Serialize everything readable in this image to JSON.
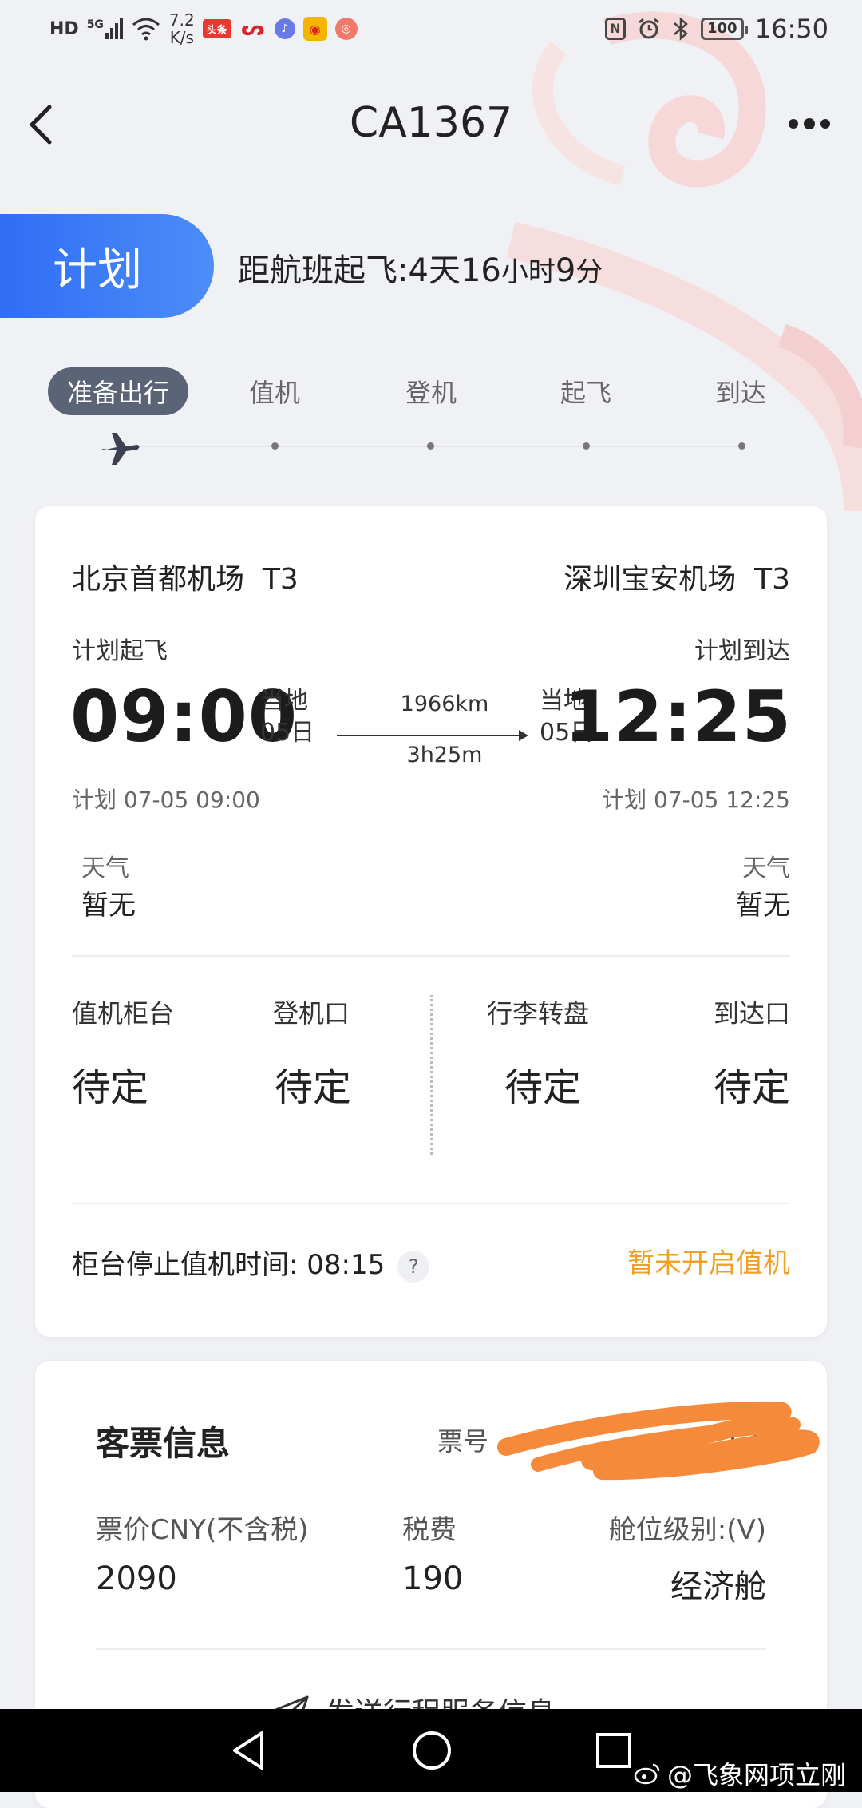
{
  "status_bar": {
    "network": "HD",
    "signal": "5G",
    "speed_value": "7.2",
    "speed_unit": "K/s",
    "app_icon_toutiao": "头条",
    "battery": "100",
    "time": "16:50"
  },
  "header": {
    "title": "CA1367"
  },
  "plan": {
    "badge": "计划",
    "countdown_prefix": "距航班起飞:",
    "days": "4",
    "days_unit": "天",
    "hours": "16",
    "hours_unit": "小时",
    "minutes": "9",
    "minutes_unit": "分"
  },
  "progress": {
    "steps": [
      "准备出行",
      "值机",
      "登机",
      "起飞",
      "到达"
    ],
    "active_index": 0
  },
  "flight": {
    "departure_airport": "北京首都机场",
    "departure_terminal": "T3",
    "arrival_airport": "深圳宝安机场",
    "arrival_terminal": "T3",
    "dep_label": "计划起飞",
    "arr_label": "计划到达",
    "dep_time": "09:00",
    "arr_time": "12:25",
    "local_label": "当地",
    "dep_day": "05日",
    "arr_day": "05日",
    "distance": "1966km",
    "duration": "3h25m",
    "dep_plan": "计划 07-05 09:00",
    "arr_plan": "计划 07-05 12:25",
    "weather_label": "天气",
    "dep_weather": "暂无",
    "arr_weather": "暂无"
  },
  "airport_info": {
    "checkin_counter_label": "值机柜台",
    "checkin_counter_value": "待定",
    "gate_label": "登机口",
    "gate_value": "待定",
    "baggage_label": "行李转盘",
    "baggage_value": "待定",
    "exit_label": "到达口",
    "exit_value": "待定"
  },
  "checkin": {
    "stop_label": "柜台停止值机时间: 08:15",
    "help": "?",
    "status": "暂未开启值机"
  },
  "ticket": {
    "title": "客票信息",
    "ticket_no_label": "票号",
    "price_label": "票价CNY(不含税)",
    "price_value": "2090",
    "tax_label": "税费",
    "tax_value": "190",
    "cabin_label": "舱位级别:(V)",
    "cabin_value": "经济舱",
    "send_label": "发送行程服务信息"
  },
  "watermark": "@飞象网项立刚",
  "colors": {
    "accent_blue": "#2f6ef5",
    "warning_orange": "#f0a024",
    "step_active": "#5b6477",
    "redaction": "#f58b3a"
  }
}
